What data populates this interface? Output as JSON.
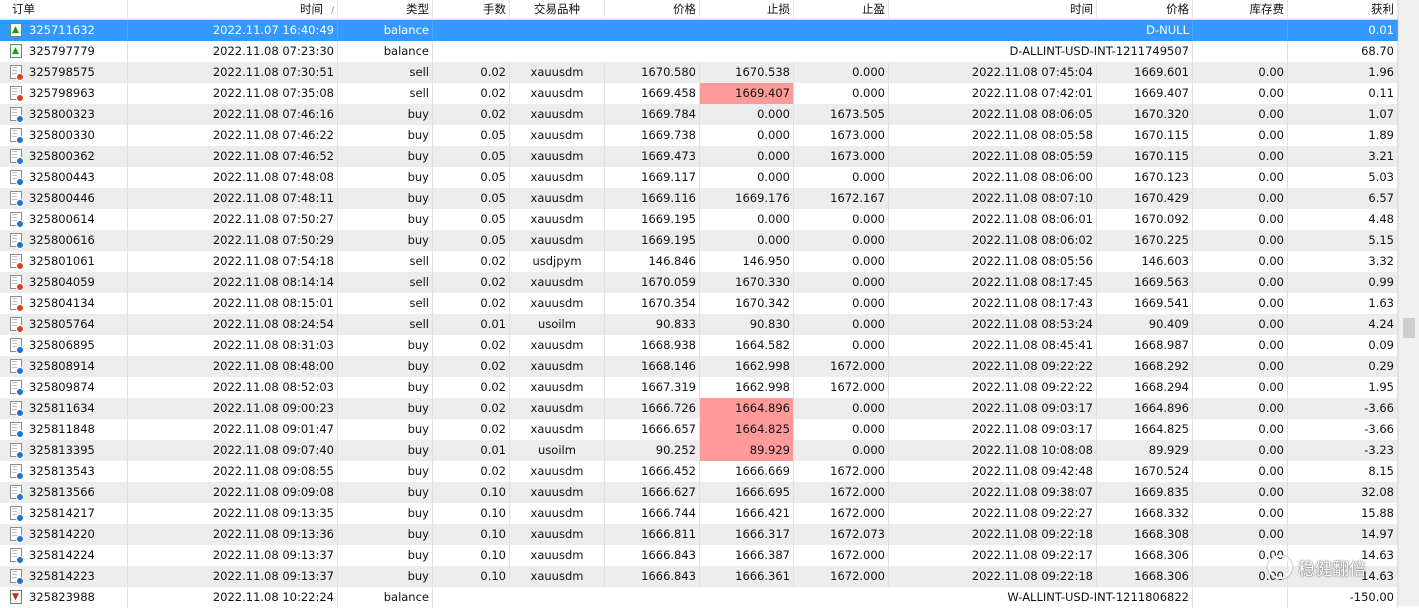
{
  "header": {
    "columns": [
      "订单",
      "时间",
      "类型",
      "手数",
      "交易品种",
      "价格",
      "止损",
      "止盈",
      "时间",
      "价格",
      "库存费",
      "获利"
    ],
    "sort_indicator": "/"
  },
  "rows": [
    {
      "kind": "balance",
      "order": "325711632",
      "open_time": "2022.11.07 16:40:49",
      "type": "balance",
      "comment": "D-NULL",
      "swap": "",
      "profit": "0.01",
      "selected": true
    },
    {
      "kind": "balance",
      "order": "325797779",
      "open_time": "2022.11.08 07:23:30",
      "type": "balance",
      "comment": "D-ALLINT-USD-INT-1211749507",
      "swap": "",
      "profit": "68.70"
    },
    {
      "kind": "trade",
      "order": "325798575",
      "open_time": "2022.11.08 07:30:51",
      "type": "sell",
      "lots": "0.02",
      "symbol": "xauusdm",
      "price": "1670.580",
      "sl": "1670.538",
      "tp": "0.000",
      "close_time": "2022.11.08 07:45:04",
      "close_price": "1669.601",
      "swap": "0.00",
      "profit": "1.96"
    },
    {
      "kind": "trade",
      "order": "325798963",
      "open_time": "2022.11.08 07:35:08",
      "type": "sell",
      "lots": "0.02",
      "symbol": "xauusdm",
      "price": "1669.458",
      "sl": "1669.407",
      "tp": "0.000",
      "close_time": "2022.11.08 07:42:01",
      "close_price": "1669.407",
      "swap": "0.00",
      "profit": "0.11",
      "sl_hit": true
    },
    {
      "kind": "trade",
      "order": "325800323",
      "open_time": "2022.11.08 07:46:16",
      "type": "buy",
      "lots": "0.02",
      "symbol": "xauusdm",
      "price": "1669.784",
      "sl": "0.000",
      "tp": "1673.505",
      "close_time": "2022.11.08 08:06:05",
      "close_price": "1670.320",
      "swap": "0.00",
      "profit": "1.07"
    },
    {
      "kind": "trade",
      "order": "325800330",
      "open_time": "2022.11.08 07:46:22",
      "type": "buy",
      "lots": "0.05",
      "symbol": "xauusdm",
      "price": "1669.738",
      "sl": "0.000",
      "tp": "1673.000",
      "close_time": "2022.11.08 08:05:58",
      "close_price": "1670.115",
      "swap": "0.00",
      "profit": "1.89"
    },
    {
      "kind": "trade",
      "order": "325800362",
      "open_time": "2022.11.08 07:46:52",
      "type": "buy",
      "lots": "0.05",
      "symbol": "xauusdm",
      "price": "1669.473",
      "sl": "0.000",
      "tp": "1673.000",
      "close_time": "2022.11.08 08:05:59",
      "close_price": "1670.115",
      "swap": "0.00",
      "profit": "3.21"
    },
    {
      "kind": "trade",
      "order": "325800443",
      "open_time": "2022.11.08 07:48:08",
      "type": "buy",
      "lots": "0.05",
      "symbol": "xauusdm",
      "price": "1669.117",
      "sl": "0.000",
      "tp": "0.000",
      "close_time": "2022.11.08 08:06:00",
      "close_price": "1670.123",
      "swap": "0.00",
      "profit": "5.03"
    },
    {
      "kind": "trade",
      "order": "325800446",
      "open_time": "2022.11.08 07:48:11",
      "type": "buy",
      "lots": "0.05",
      "symbol": "xauusdm",
      "price": "1669.116",
      "sl": "1669.176",
      "tp": "1672.167",
      "close_time": "2022.11.08 08:07:10",
      "close_price": "1670.429",
      "swap": "0.00",
      "profit": "6.57"
    },
    {
      "kind": "trade",
      "order": "325800614",
      "open_time": "2022.11.08 07:50:27",
      "type": "buy",
      "lots": "0.05",
      "symbol": "xauusdm",
      "price": "1669.195",
      "sl": "0.000",
      "tp": "0.000",
      "close_time": "2022.11.08 08:06:01",
      "close_price": "1670.092",
      "swap": "0.00",
      "profit": "4.48"
    },
    {
      "kind": "trade",
      "order": "325800616",
      "open_time": "2022.11.08 07:50:29",
      "type": "buy",
      "lots": "0.05",
      "symbol": "xauusdm",
      "price": "1669.195",
      "sl": "0.000",
      "tp": "0.000",
      "close_time": "2022.11.08 08:06:02",
      "close_price": "1670.225",
      "swap": "0.00",
      "profit": "5.15"
    },
    {
      "kind": "trade",
      "order": "325801061",
      "open_time": "2022.11.08 07:54:18",
      "type": "sell",
      "lots": "0.02",
      "symbol": "usdjpym",
      "price": "146.846",
      "sl": "146.950",
      "tp": "0.000",
      "close_time": "2022.11.08 08:05:56",
      "close_price": "146.603",
      "swap": "0.00",
      "profit": "3.32"
    },
    {
      "kind": "trade",
      "order": "325804059",
      "open_time": "2022.11.08 08:14:14",
      "type": "sell",
      "lots": "0.02",
      "symbol": "xauusdm",
      "price": "1670.059",
      "sl": "1670.330",
      "tp": "0.000",
      "close_time": "2022.11.08 08:17:45",
      "close_price": "1669.563",
      "swap": "0.00",
      "profit": "0.99"
    },
    {
      "kind": "trade",
      "order": "325804134",
      "open_time": "2022.11.08 08:15:01",
      "type": "sell",
      "lots": "0.02",
      "symbol": "xauusdm",
      "price": "1670.354",
      "sl": "1670.342",
      "tp": "0.000",
      "close_time": "2022.11.08 08:17:43",
      "close_price": "1669.541",
      "swap": "0.00",
      "profit": "1.63"
    },
    {
      "kind": "trade",
      "order": "325805764",
      "open_time": "2022.11.08 08:24:54",
      "type": "sell",
      "lots": "0.01",
      "symbol": "usoilm",
      "price": "90.833",
      "sl": "90.830",
      "tp": "0.000",
      "close_time": "2022.11.08 08:53:24",
      "close_price": "90.409",
      "swap": "0.00",
      "profit": "4.24"
    },
    {
      "kind": "trade",
      "order": "325806895",
      "open_time": "2022.11.08 08:31:03",
      "type": "buy",
      "lots": "0.02",
      "symbol": "xauusdm",
      "price": "1668.938",
      "sl": "1664.582",
      "tp": "0.000",
      "close_time": "2022.11.08 08:45:41",
      "close_price": "1668.987",
      "swap": "0.00",
      "profit": "0.09"
    },
    {
      "kind": "trade",
      "order": "325808914",
      "open_time": "2022.11.08 08:48:00",
      "type": "buy",
      "lots": "0.02",
      "symbol": "xauusdm",
      "price": "1668.146",
      "sl": "1662.998",
      "tp": "1672.000",
      "close_time": "2022.11.08 09:22:22",
      "close_price": "1668.292",
      "swap": "0.00",
      "profit": "0.29"
    },
    {
      "kind": "trade",
      "order": "325809874",
      "open_time": "2022.11.08 08:52:03",
      "type": "buy",
      "lots": "0.02",
      "symbol": "xauusdm",
      "price": "1667.319",
      "sl": "1662.998",
      "tp": "1672.000",
      "close_time": "2022.11.08 09:22:22",
      "close_price": "1668.294",
      "swap": "0.00",
      "profit": "1.95"
    },
    {
      "kind": "trade",
      "order": "325811634",
      "open_time": "2022.11.08 09:00:23",
      "type": "buy",
      "lots": "0.02",
      "symbol": "xauusdm",
      "price": "1666.726",
      "sl": "1664.896",
      "tp": "0.000",
      "close_time": "2022.11.08 09:03:17",
      "close_price": "1664.896",
      "swap": "0.00",
      "profit": "-3.66",
      "sl_hit": true
    },
    {
      "kind": "trade",
      "order": "325811848",
      "open_time": "2022.11.08 09:01:47",
      "type": "buy",
      "lots": "0.02",
      "symbol": "xauusdm",
      "price": "1666.657",
      "sl": "1664.825",
      "tp": "0.000",
      "close_time": "2022.11.08 09:03:17",
      "close_price": "1664.825",
      "swap": "0.00",
      "profit": "-3.66",
      "sl_hit": true
    },
    {
      "kind": "trade",
      "order": "325813395",
      "open_time": "2022.11.08 09:07:40",
      "type": "buy",
      "lots": "0.01",
      "symbol": "usoilm",
      "price": "90.252",
      "sl": "89.929",
      "tp": "0.000",
      "close_time": "2022.11.08 10:08:08",
      "close_price": "89.929",
      "swap": "0.00",
      "profit": "-3.23",
      "sl_hit": true
    },
    {
      "kind": "trade",
      "order": "325813543",
      "open_time": "2022.11.08 09:08:55",
      "type": "buy",
      "lots": "0.02",
      "symbol": "xauusdm",
      "price": "1666.452",
      "sl": "1666.669",
      "tp": "1672.000",
      "close_time": "2022.11.08 09:42:48",
      "close_price": "1670.524",
      "swap": "0.00",
      "profit": "8.15"
    },
    {
      "kind": "trade",
      "order": "325813566",
      "open_time": "2022.11.08 09:09:08",
      "type": "buy",
      "lots": "0.10",
      "symbol": "xauusdm",
      "price": "1666.627",
      "sl": "1666.695",
      "tp": "1672.000",
      "close_time": "2022.11.08 09:38:07",
      "close_price": "1669.835",
      "swap": "0.00",
      "profit": "32.08"
    },
    {
      "kind": "trade",
      "order": "325814217",
      "open_time": "2022.11.08 09:13:35",
      "type": "buy",
      "lots": "0.10",
      "symbol": "xauusdm",
      "price": "1666.744",
      "sl": "1666.421",
      "tp": "1672.000",
      "close_time": "2022.11.08 09:22:27",
      "close_price": "1668.332",
      "swap": "0.00",
      "profit": "15.88"
    },
    {
      "kind": "trade",
      "order": "325814220",
      "open_time": "2022.11.08 09:13:36",
      "type": "buy",
      "lots": "0.10",
      "symbol": "xauusdm",
      "price": "1666.811",
      "sl": "1666.317",
      "tp": "1672.073",
      "close_time": "2022.11.08 09:22:18",
      "close_price": "1668.308",
      "swap": "0.00",
      "profit": "14.97"
    },
    {
      "kind": "trade",
      "order": "325814224",
      "open_time": "2022.11.08 09:13:37",
      "type": "buy",
      "lots": "0.10",
      "symbol": "xauusdm",
      "price": "1666.843",
      "sl": "1666.387",
      "tp": "1672.000",
      "close_time": "2022.11.08 09:22:17",
      "close_price": "1668.306",
      "swap": "0.00",
      "profit": "14.63"
    },
    {
      "kind": "trade",
      "order": "325814223",
      "open_time": "2022.11.08 09:13:37",
      "type": "buy",
      "lots": "0.10",
      "symbol": "xauusdm",
      "price": "1666.843",
      "sl": "1666.361",
      "tp": "1672.000",
      "close_time": "2022.11.08 09:22:18",
      "close_price": "1668.306",
      "swap": "0.00",
      "profit": "14.63"
    },
    {
      "kind": "balance",
      "order": "325823988",
      "open_time": "2022.11.08 10:22:24",
      "type": "balance",
      "comment": "W-ALLINT-USD-INT-1211806822",
      "swap": "",
      "profit": "-150.00",
      "withdrawal": true
    }
  ],
  "watermark": {
    "text": "稳健翻倍"
  },
  "colors": {
    "selected_row": "#3399ff",
    "zebra_row": "#ececec",
    "sl_highlight": "#ff9a9a",
    "buy_icon": "#1e73d6",
    "sell_icon": "#e0401e"
  }
}
